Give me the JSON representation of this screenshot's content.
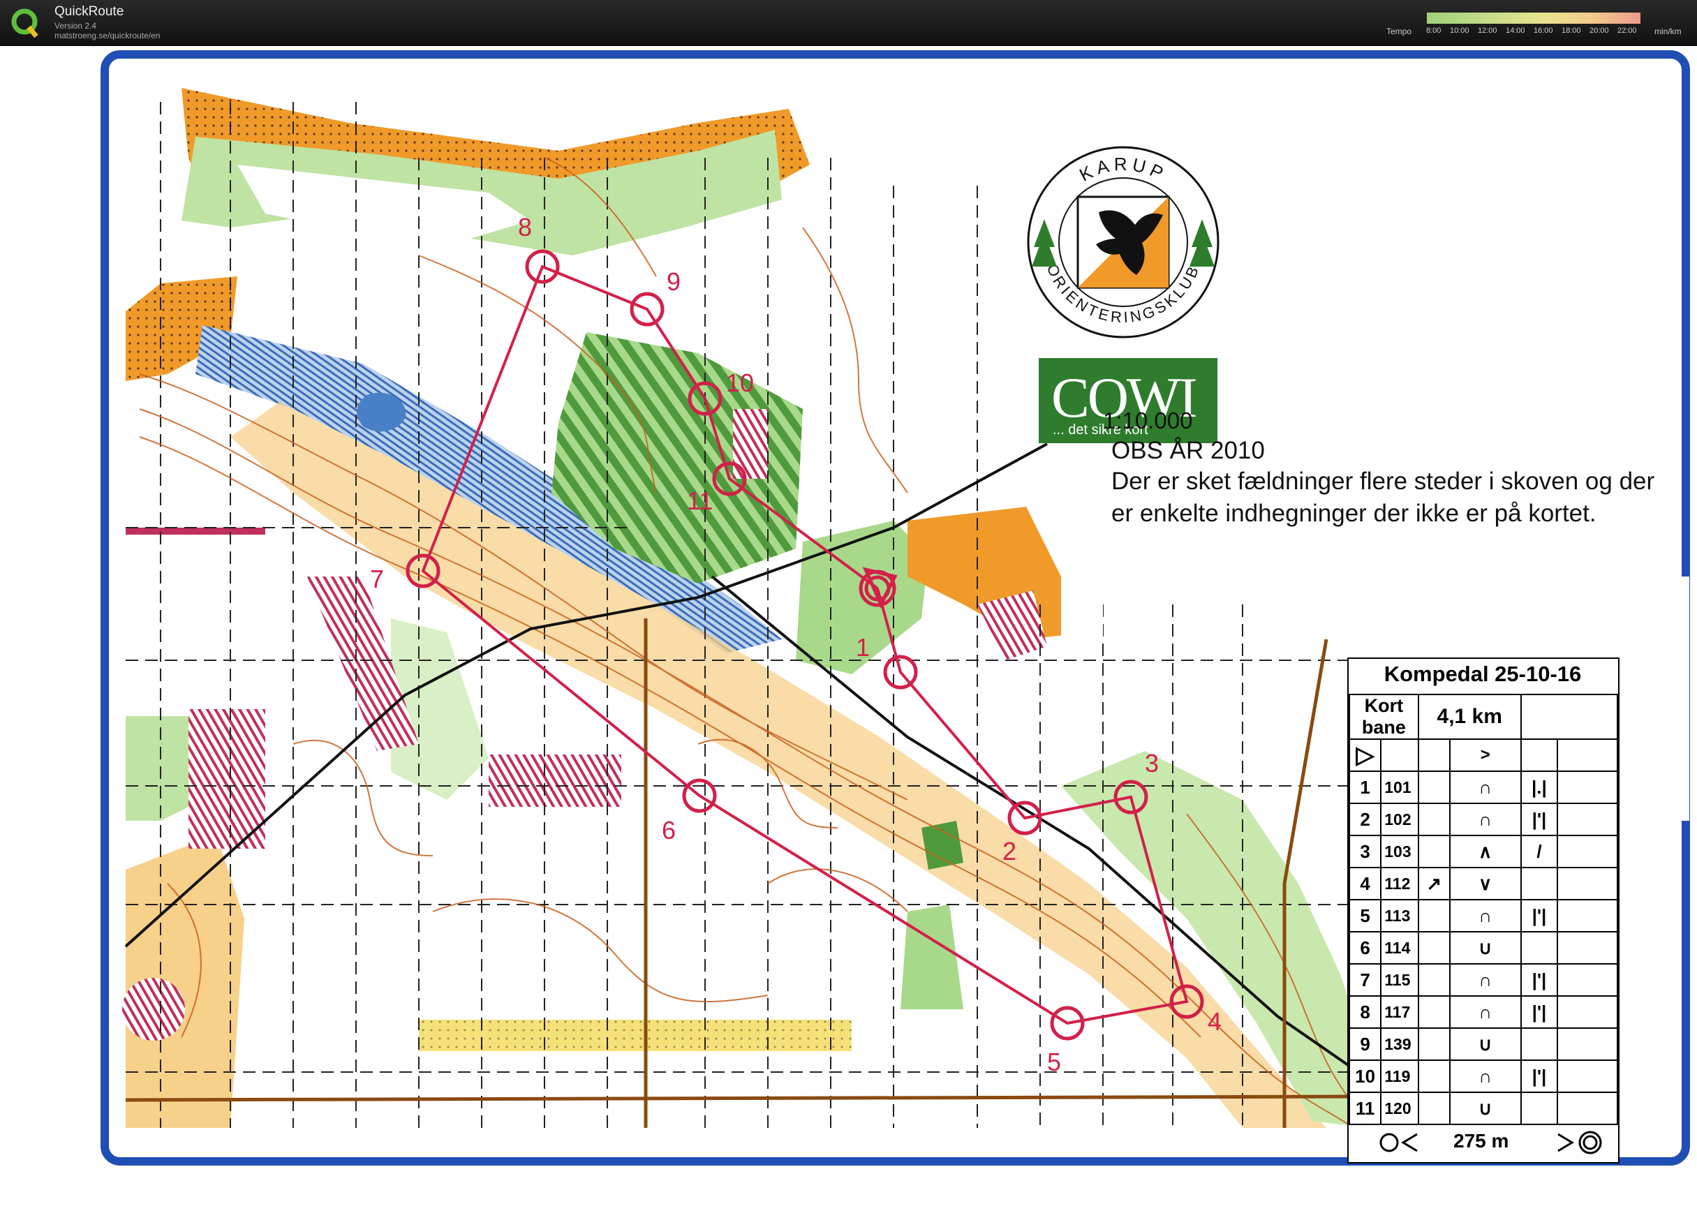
{
  "app": {
    "title": "QuickRoute",
    "version": "Version 2.4",
    "url": "matstroeng.se/quickroute/en",
    "tempo_label": "Tempo",
    "tempo_ticks": [
      "8:00",
      "10:00",
      "12:00",
      "14:00",
      "16:00",
      "18:00",
      "20:00",
      "22:00"
    ],
    "tempo_unit": "min/km",
    "tempo_gradient": [
      "#9fd27a",
      "#c7dc8a",
      "#e9e38e",
      "#f2c98a",
      "#ee9a8a"
    ]
  },
  "map": {
    "club_top": "KARUP",
    "club_bottom": "ORIENTERINGSKLUB",
    "cowi_word": "COWI",
    "cowi_slogan": "... det sikre kort",
    "scale": "1:10.000",
    "notice_title": "OBS ÅR 2010",
    "notice_body": "Der er sket fældninger flere steder i skoven og der er enkelte indhegninger der ikke er på kortet.",
    "colors": {
      "frame": "#1f4fb4",
      "course": "#d2204a",
      "open_land": "#f6c56d",
      "rough_open": "#f5e17a",
      "vegetation": "#a8d98a",
      "dense_green": "#4f9a3c",
      "contour": "#c8601e",
      "water": "#4a80c8",
      "rough_orange": "#f09a2a"
    },
    "controls": [
      "1",
      "2",
      "3",
      "4",
      "5",
      "6",
      "7",
      "8",
      "9",
      "10",
      "11"
    ]
  },
  "card": {
    "title": "Kompedal 25-10-16",
    "course_label": "Kort bane",
    "length": "4,1 km",
    "start_symbol": "▷",
    "rows": [
      {
        "n": "1",
        "code": "101",
        "d": "",
        "f": "∩",
        "s": "|.|"
      },
      {
        "n": "2",
        "code": "102",
        "d": "",
        "f": "∩",
        "s": "|'|"
      },
      {
        "n": "3",
        "code": "103",
        "d": "",
        "f": "∧",
        "s": "/"
      },
      {
        "n": "4",
        "code": "112",
        "d": "↗",
        "f": "∨",
        "s": ""
      },
      {
        "n": "5",
        "code": "113",
        "d": "",
        "f": "∩",
        "s": "|'|"
      },
      {
        "n": "6",
        "code": "114",
        "d": "",
        "f": "∪",
        "s": ""
      },
      {
        "n": "7",
        "code": "115",
        "d": "",
        "f": "∩",
        "s": "|'|"
      },
      {
        "n": "8",
        "code": "117",
        "d": "",
        "f": "∩",
        "s": "|'|"
      },
      {
        "n": "9",
        "code": "139",
        "d": "",
        "f": "∪",
        "s": ""
      },
      {
        "n": "10",
        "code": "119",
        "d": "",
        "f": "∩",
        "s": "|'|"
      },
      {
        "n": "11",
        "code": "120",
        "d": "",
        "f": "∪",
        "s": ""
      }
    ],
    "finish_distance": "275 m"
  }
}
